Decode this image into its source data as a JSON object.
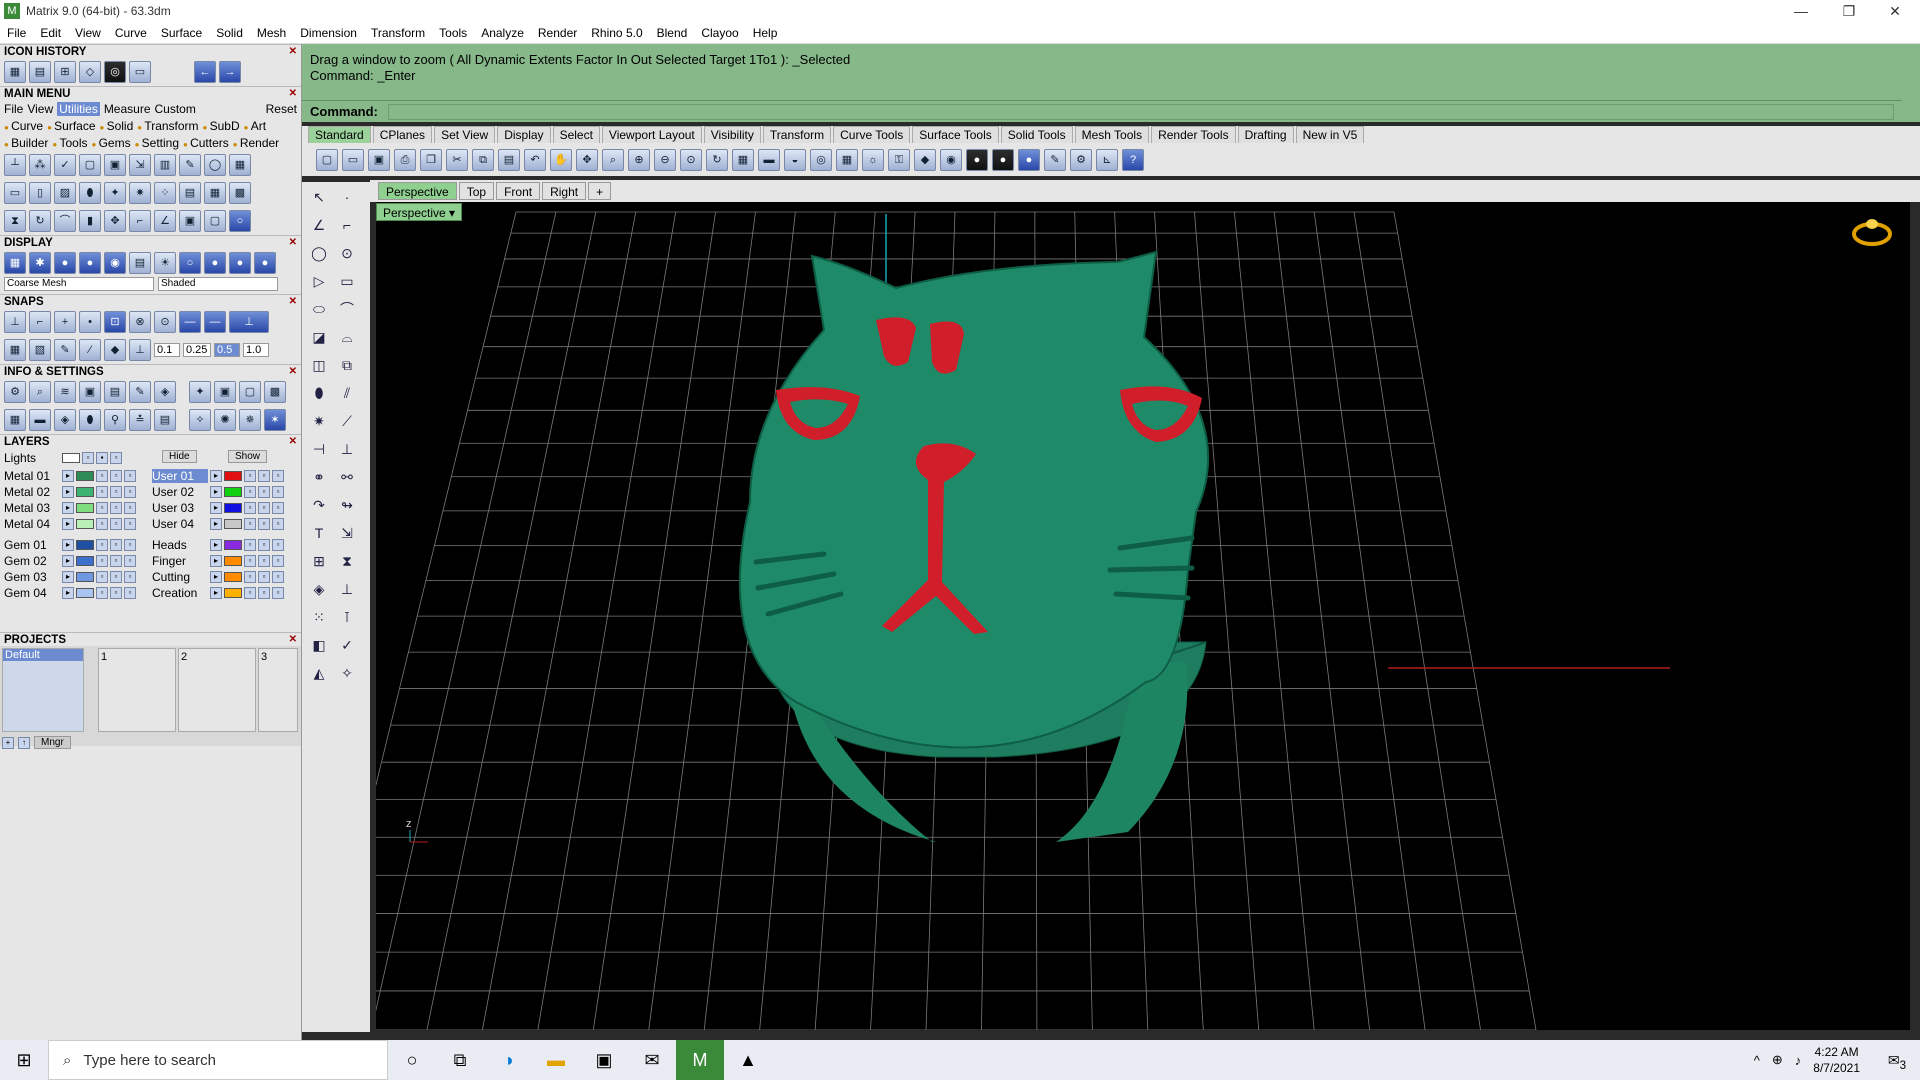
{
  "window": {
    "title": "Matrix 9.0 (64-bit) - 63.3dm",
    "icon": "matrix-icon"
  },
  "menu": [
    "File",
    "Edit",
    "View",
    "Curve",
    "Surface",
    "Solid",
    "Mesh",
    "Dimension",
    "Transform",
    "Tools",
    "Analyze",
    "Render",
    "Rhino 5.0",
    "Blend",
    "Clayoo",
    "Help"
  ],
  "left": {
    "icon_history": "ICON HISTORY",
    "main_menu": "MAIN MENU",
    "mm_row1": [
      "File",
      "View",
      "Utilities",
      "Measure",
      "Custom",
      "Reset"
    ],
    "mm_row2": [
      "Curve",
      "Surface",
      "Solid",
      "Transform",
      "SubD",
      "Art"
    ],
    "mm_row3": [
      "Builder",
      "Tools",
      "Gems",
      "Setting",
      "Cutters",
      "Render"
    ],
    "display": "DISPLAY",
    "display_mesh": "Coarse Mesh",
    "display_mode": "Shaded",
    "snaps": "SNAPS",
    "snap_values": [
      "0.1",
      "0.25",
      "0.5",
      "1.0"
    ],
    "info": "INFO & SETTINGS",
    "layers": "LAYERS",
    "lights": "Lights",
    "hide": "Hide",
    "show": "Show",
    "layer_left": [
      "Metal 01",
      "Metal 02",
      "Metal 03",
      "Metal 04",
      "Gem 01",
      "Gem 02",
      "Gem 03",
      "Gem 04"
    ],
    "layer_right": [
      "User 01",
      "User 02",
      "User 03",
      "User 04",
      "Heads",
      "Finger",
      "Cutting",
      "Creation"
    ],
    "layer_left_colors": [
      "#2e8b57",
      "#3cb371",
      "#7fdd7f",
      "#b8f0b8",
      "#1f4fa0",
      "#3d6fcf",
      "#6f98e0",
      "#a9c4f0"
    ],
    "layer_right_colors": [
      "#e01010",
      "#10d010",
      "#1010e0",
      "#c8c8c8",
      "#8a2be2",
      "#ff8c00",
      "#ff8c00",
      "#ffb000"
    ],
    "projects": "PROJECTS",
    "project_default": "Default",
    "project_slots": [
      "1",
      "2",
      "3"
    ],
    "mngr": "Mngr"
  },
  "command": {
    "prompt": "Drag a window to zoom ( All  Dynamic  Extents  Factor  In  Out  Selected  Target  1To1 ): _Selected",
    "history": "Command: _Enter",
    "label": "Command:",
    "value": ""
  },
  "toolbar_tabs": [
    "Standard",
    "CPlanes",
    "Set View",
    "Display",
    "Select",
    "Viewport Layout",
    "Visibility",
    "Transform",
    "Curve Tools",
    "Surface Tools",
    "Solid Tools",
    "Mesh Tools",
    "Render Tools",
    "Drafting",
    "New in V5"
  ],
  "viewport_tabs": [
    "Perspective",
    "Top",
    "Front",
    "Right",
    "+"
  ],
  "viewport_label": "Perspective",
  "axis_label": "z",
  "model": {
    "body_color": "#1f8a68",
    "accent_color": "#d01e2a"
  },
  "taskbar": {
    "search_placeholder": "Type here to search",
    "time": "4:22 AM",
    "date": "8/7/2021",
    "notifications": "3"
  }
}
